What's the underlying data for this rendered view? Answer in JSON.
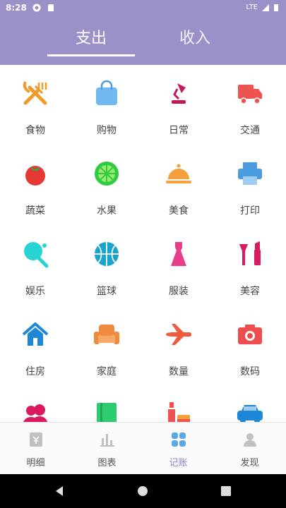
{
  "status_bar": {
    "time": "8:28",
    "network": "LTE"
  },
  "tabs": [
    {
      "label": "支出",
      "active": true
    },
    {
      "label": "收入",
      "active": false
    }
  ],
  "categories": [
    {
      "label": "食物",
      "icon": "fork-knife-icon",
      "color": "#f29b2a"
    },
    {
      "label": "购物",
      "icon": "shopping-bag-icon",
      "color": "#6fb8f2"
    },
    {
      "label": "日常",
      "icon": "desk-lamp-icon",
      "color": "#c2185b"
    },
    {
      "label": "交通",
      "icon": "truck-icon",
      "color": "#ef5350"
    },
    {
      "label": "蔬菜",
      "icon": "tomato-icon",
      "color": "#e53935"
    },
    {
      "label": "水果",
      "icon": "lime-icon",
      "color": "#2ecc40"
    },
    {
      "label": "美食",
      "icon": "food-cloche-icon",
      "color": "#f4a13d"
    },
    {
      "label": "打印",
      "icon": "printer-icon",
      "color": "#4a9be0"
    },
    {
      "label": "娱乐",
      "icon": "ping-pong-icon",
      "color": "#26d4d4"
    },
    {
      "label": "篮球",
      "icon": "basketball-icon",
      "color": "#1aa3cc"
    },
    {
      "label": "服装",
      "icon": "dress-icon",
      "color": "#e83e8c"
    },
    {
      "label": "美容",
      "icon": "lipstick-icon",
      "color": "#d81b60"
    },
    {
      "label": "住房",
      "icon": "house-icon",
      "color": "#1f88d6"
    },
    {
      "label": "家庭",
      "icon": "sofa-icon",
      "color": "#f08a3e"
    },
    {
      "label": "数量",
      "icon": "airplane-icon",
      "color": "#ef5b3f"
    },
    {
      "label": "数码",
      "icon": "camera-icon",
      "color": "#ef4d4d"
    },
    {
      "label": "",
      "icon": "people-icon",
      "color": "#d81b60"
    },
    {
      "label": "",
      "icon": "notebook-icon",
      "color": "#2ecc71"
    },
    {
      "label": "",
      "icon": "wine-food-icon",
      "color": "#ef5350"
    },
    {
      "label": "",
      "icon": "car-icon",
      "color": "#1f88d6"
    }
  ],
  "bottom_nav": [
    {
      "label": "明细",
      "icon": "details-icon",
      "active": false
    },
    {
      "label": "图表",
      "icon": "chart-icon",
      "active": false
    },
    {
      "label": "记账",
      "icon": "bookkeeping-icon",
      "active": true
    },
    {
      "label": "发现",
      "icon": "discover-icon",
      "active": false
    }
  ],
  "colors": {
    "header": "#9b91c8",
    "accent": "#8a84c8",
    "nav_icon": "#c0c0c0",
    "nav_icon_active": "#5aa8e6"
  }
}
